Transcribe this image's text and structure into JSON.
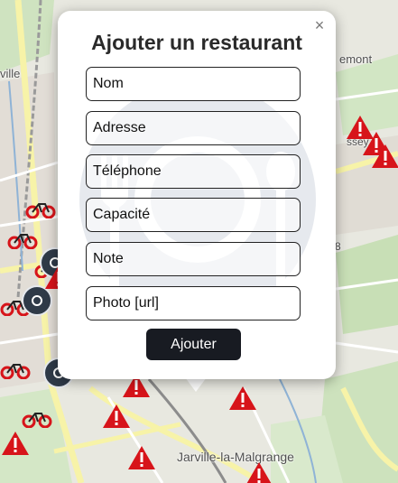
{
  "map": {
    "labels": {
      "jarville": "Jarville-la-Malgrange",
      "emont": "emont",
      "ville": "ville",
      "ssey": "ssey",
      "num8": "8"
    }
  },
  "popup": {
    "title": "Ajouter un restaurant",
    "close_icon": "×",
    "fields": {
      "nom": "Nom",
      "adresse": "Adresse",
      "telephone": "Téléphone",
      "capacite": "Capacité",
      "note": "Note",
      "photo": "Photo [url]"
    },
    "submit_label": "Ajouter"
  },
  "colors": {
    "warning_marker": "#d7141a",
    "bike_marker": "#d7141a",
    "restaurant_marker": "#2f3a48",
    "submit_button": "#181b22"
  },
  "icons": {
    "restaurant_watermark": "plate-cutlery-icon",
    "bike_marker": "bicycle-icon",
    "warning_marker": "warning-triangle-icon",
    "close": "close-icon"
  }
}
